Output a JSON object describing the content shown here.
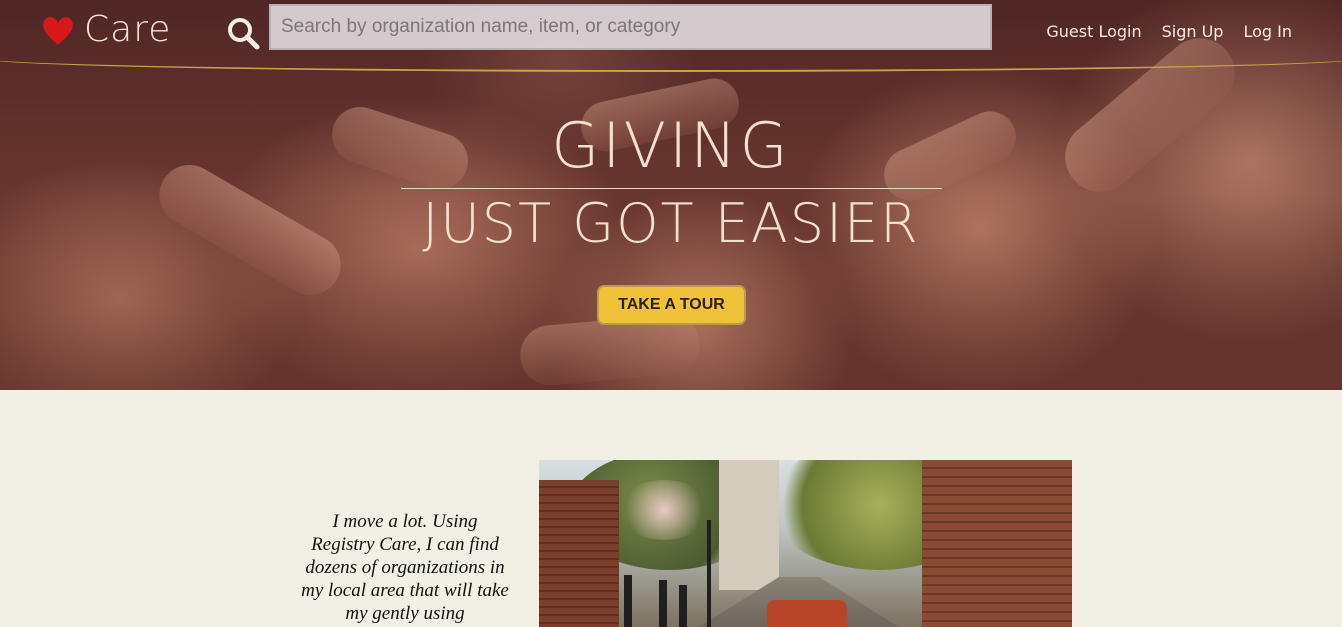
{
  "brand": {
    "name": "Care",
    "heart_color": "#d7191c"
  },
  "search": {
    "placeholder": "Search by organization name, item, or category"
  },
  "nav": {
    "guest_login": "Guest Login",
    "sign_up": "Sign Up",
    "log_in": "Log In"
  },
  "hero": {
    "title": "GIVING",
    "subtitle": "JUST GOT EASIER",
    "cta": "TAKE A TOUR"
  },
  "testimonial": {
    "text": "I move a lot. Using Registry Care, I can find dozens of organizations in my local area that will take my gently using"
  },
  "colors": {
    "accent": "#f0c23a",
    "header_rule": "#c9a24c",
    "page_background": "#f2efe5"
  }
}
